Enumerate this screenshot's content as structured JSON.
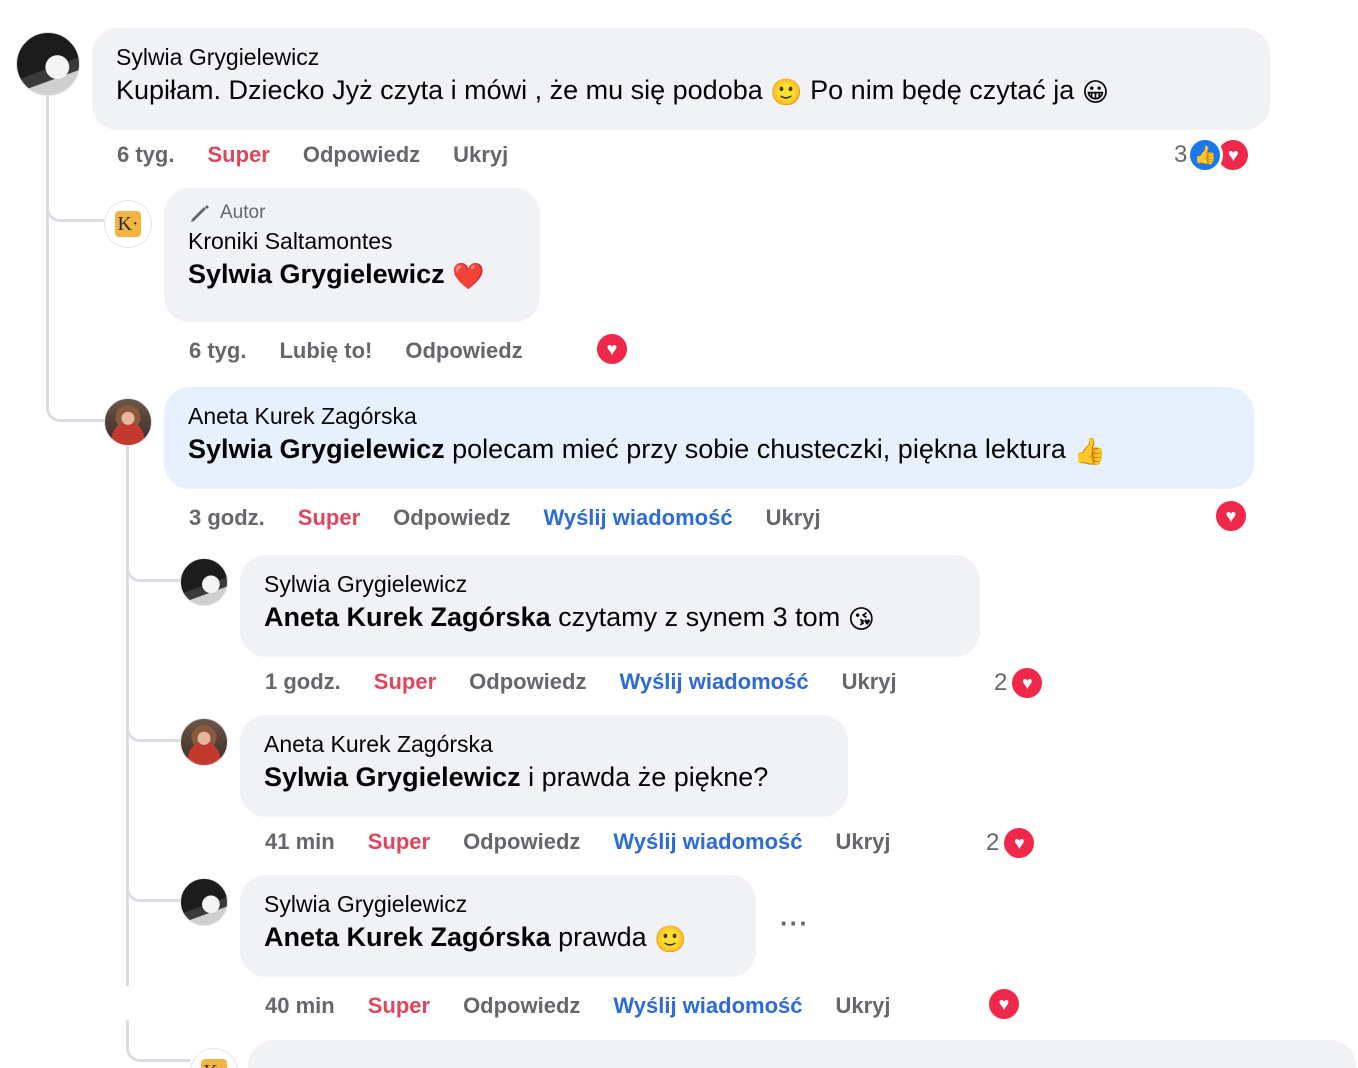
{
  "comments": [
    {
      "author": "Sylwia Grygielewicz",
      "text": "Kupiłam. Dziecko Jyż czyta i mówi , że mu się podoba",
      "text_emoji": "🙂",
      "text_after": "Po nim będę czytać ja",
      "text_emoji2": "😀",
      "time": "6 tyg.",
      "super": "Super",
      "reply": "Odpowiedz",
      "hide": "Ukryj",
      "reaction_count": "3"
    },
    {
      "badge": "Autor",
      "author": "Kroniki Saltamontes",
      "mention": "Sylwia Grygielewicz",
      "text_emoji": "❤️",
      "time": "6 tyg.",
      "like": "Lubię to!",
      "reply": "Odpowiedz",
      "logo_letter": "K·"
    },
    {
      "author": "Aneta Kurek Zagórska",
      "mention": "Sylwia Grygielewicz",
      "text": "polecam mieć przy sobie chusteczki, piękna lektura",
      "text_emoji": "👍",
      "time": "3 godz.",
      "super": "Super",
      "reply": "Odpowiedz",
      "message": "Wyślij wiadomość",
      "hide": "Ukryj"
    },
    {
      "author": "Sylwia Grygielewicz",
      "mention": "Aneta Kurek Zagórska",
      "text": "czytamy z synem 3 tom",
      "text_emoji": "😘",
      "time": "1 godz.",
      "super": "Super",
      "reply": "Odpowiedz",
      "message": "Wyślij wiadomość",
      "hide": "Ukryj",
      "reaction_count": "2"
    },
    {
      "author": "Aneta Kurek Zagórska",
      "mention": "Sylwia Grygielewicz",
      "text": "i prawda że piękne?",
      "time": "41 min",
      "super": "Super",
      "reply": "Odpowiedz",
      "message": "Wyślij wiadomość",
      "hide": "Ukryj",
      "reaction_count": "2"
    },
    {
      "author": "Sylwia Grygielewicz",
      "mention": "Aneta Kurek Zagórska",
      "text": "prawda",
      "text_emoji": "🙂",
      "time": "40 min",
      "super": "Super",
      "reply": "Odpowiedz",
      "message": "Wyślij wiadomość",
      "hide": "Ukryj",
      "more": "···"
    }
  ],
  "colors": {
    "super": "#e0455b",
    "message_link": "#2d6bd8",
    "bubble": "#f0f2f5",
    "highlight_bubble": "#e7f1fd",
    "heart": "#f0284a",
    "like": "#1877f2"
  }
}
